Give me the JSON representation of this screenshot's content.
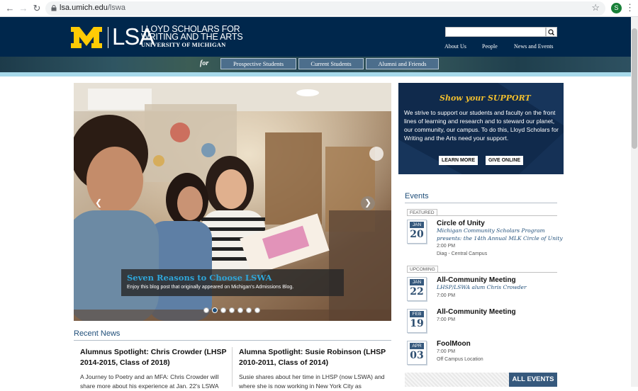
{
  "browser": {
    "url_host": "lsa.umich.edu",
    "url_path": "/lswa",
    "avatar_letter": "S"
  },
  "header": {
    "logo_m": "M",
    "logo_lsa": "LSA",
    "logo_line1": "LLOYD SCHOLARS FOR",
    "logo_line2": "WRITING AND THE ARTS",
    "logo_line3": "UNIVERSITY OF MICHIGAN",
    "search_placeholder": "",
    "nav": [
      "About Us",
      "People",
      "News and Events"
    ]
  },
  "audience": {
    "for_label": "for",
    "buttons": [
      "Prospective Students",
      "Current Students",
      "Alumni and Friends"
    ]
  },
  "hero": {
    "caption_title": "Seven Reasons to Choose LSWA",
    "caption_sub": "Enjoy this blog post that originally appeared on Michigan's Admissions Blog.",
    "slide_count": 7,
    "active_slide": 2
  },
  "support": {
    "title_prefix": "Show your ",
    "title_emph": "SUPPORT",
    "body": "We strive to support our students and faculty on the front lines of learning and research and to steward our planet, our community, our campus. To do this, Lloyd Scholars for Writing and the Arts need your support.",
    "learn_more": "LEARN MORE",
    "give_online": "GIVE ONLINE"
  },
  "events": {
    "title": "Events",
    "featured_label": "FEATURED",
    "upcoming_label": "UPCOMING",
    "items": [
      {
        "month": "JAN",
        "day": "20",
        "name": "Circle of Unity",
        "sub": "Michigan Community Scholars Program presents: the 14th Annual MLK Circle of Unity",
        "time": "2:00 PM",
        "location": "Diag - Central Campus"
      },
      {
        "month": "JAN",
        "day": "22",
        "name": "All-Community Meeting",
        "sub": "LHSP/LSWA alum Chris Crowder",
        "time": "7:00 PM",
        "location": ""
      },
      {
        "month": "FEB",
        "day": "19",
        "name": "All-Community Meeting",
        "sub": "",
        "time": "7:00 PM",
        "location": ""
      },
      {
        "month": "APR",
        "day": "03",
        "name": "FoolMoon",
        "sub": "",
        "time": "7:00 PM",
        "location": "Off Campus Location"
      }
    ],
    "all_events": "ALL EVENTS"
  },
  "news": {
    "title": "Recent News",
    "items": [
      {
        "headline": "Alumnus Spotlight: Chris Crowder (LHSP 2014-2015, Class of 2018)",
        "body": "A Journey to Poetry and an MFA: Chris Crowder will share more about his experience at Jan. 22's LSWA"
      },
      {
        "headline": "Alumna Spotlight: Susie Robinson (LHSP 2010-2011, Class of 2014)",
        "body": "Susie shares about her time in LHSP (now LSWA) and where she is now working in New York City as"
      }
    ]
  },
  "colors": {
    "navy": "#00274c",
    "maize": "#ffcb05",
    "accent_blue": "#2fa6d9",
    "support_gold": "#f0be2e"
  }
}
